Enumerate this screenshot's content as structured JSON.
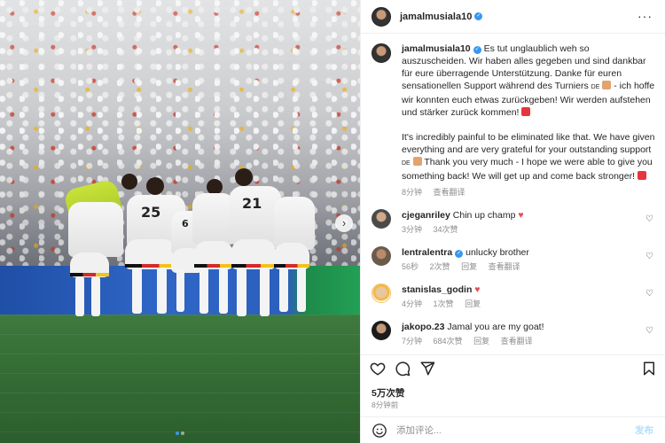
{
  "account": {
    "username": "jamalmusiala10"
  },
  "header": {
    "more_label": "···"
  },
  "caption": {
    "username": "jamalmusiala10",
    "de_text_1": "Es tut unglaublich weh so auszuscheiden. Wir haben alles gegeben und sind dankbar für eure überragende Unterstützung. Danke für euren sensationellen Support während des Turniers",
    "de_flag": "DE",
    "de_text_2": "- ich hoffe wir konnten euch etwas zurückgeben! Wir werden aufstehen und stärker zurück kommen!",
    "en_text_1": "It's incredibly painful to be eliminated like that. We have given everything and are very grateful for your outstanding support",
    "en_flag": "DE",
    "en_text_2": "Thank you very much - I hope we were able to give you something back! We will get up and come back stronger!",
    "age": "8分钟",
    "see_translation": "查看翻译"
  },
  "comments": [
    {
      "username": "cjeganriley",
      "verified": false,
      "text": "Chin up champ",
      "heart_emoji": true,
      "age": "3分钟",
      "likes": "34次赞",
      "reply": "",
      "translate": ""
    },
    {
      "username": "lentralentra",
      "verified": true,
      "text": "unlucky brother",
      "heart_emoji": false,
      "age": "56秒",
      "likes": "2次赞",
      "reply": "回复",
      "translate": "查看翻译"
    },
    {
      "username": "stanislas_godin",
      "verified": false,
      "text": "",
      "heart_emoji": true,
      "age": "4分钟",
      "likes": "1次赞",
      "reply": "回复",
      "translate": ""
    },
    {
      "username": "jakopo.23",
      "verified": false,
      "text": "Jamal you are my goat!",
      "heart_emoji": false,
      "age": "7分钟",
      "likes": "684次赞",
      "reply": "回复",
      "translate": "查看翻译"
    }
  ],
  "stats": {
    "likes": "5万次赞",
    "time": "8分钟前"
  },
  "compose": {
    "placeholder": "添加评论...",
    "post_label": "发布"
  },
  "media": {
    "jersey_numbers": [
      "25",
      "21",
      "6"
    ]
  },
  "colors": {
    "verified": "#3897f0",
    "heart": "#ed4956"
  }
}
